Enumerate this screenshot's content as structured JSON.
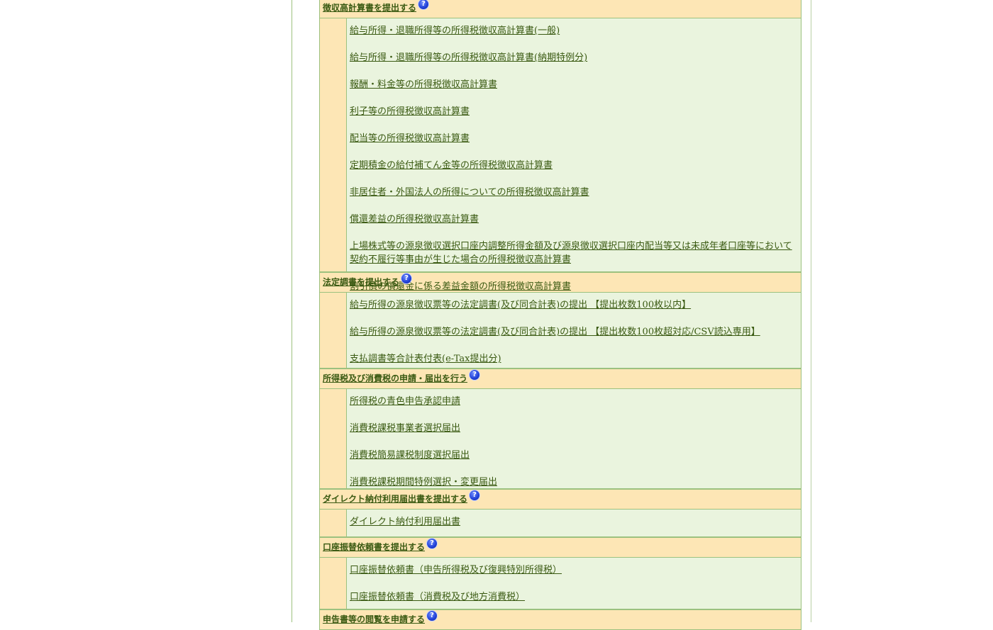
{
  "sections": [
    {
      "title": "徴収高計算書を提出する",
      "items": [
        "給与所得・退職所得等の所得税徴収高計算書(一般)",
        "給与所得・退職所得等の所得税徴収高計算書(納期特例分)",
        "報酬・料金等の所得税徴収高計算書",
        "利子等の所得税徴収高計算書",
        "配当等の所得税徴収高計算書",
        "定期積金の給付補てん金等の所得税徴収高計算書",
        "非居住者・外国法人の所得についての所得税徴収高計算書",
        "償還差益の所得税徴収高計算書",
        "上場株式等の源泉徴収選択口座内調整所得金額及び源泉徴収選択口座内配当等又は未成年者口座等において契約不履行等事由が生じた場合の所得税徴収高計算書",
        "割引債の償還金に係る差益金額の所得税徴収高計算書"
      ]
    },
    {
      "title": "法定調書を提出する",
      "items": [
        "給与所得の源泉徴収票等の法定調書(及び同合計表)の提出 【提出枚数100枚以内】",
        "給与所得の源泉徴収票等の法定調書(及び同合計表)の提出 【提出枚数100枚超対応/CSV読込専用】",
        "支払調書等合計表付表(e-Tax提出分)"
      ]
    },
    {
      "title": "所得税及び消費税の申請・届出を行う",
      "items": [
        "所得税の青色申告承認申請",
        "消費税課税事業者選択届出",
        "消費税簡易課税制度選択届出",
        "消費税課税期間特例選択・変更届出"
      ]
    },
    {
      "title": "ダイレクト納付利用届出書を提出する",
      "items": [
        "ダイレクト納付利用届出書"
      ]
    },
    {
      "title": "口座振替依頼書を提出する",
      "items": [
        "口座振替依頼書（申告所得税及び復興特別所得税）",
        "口座振替依頼書（消費税及び地方消費税）"
      ]
    },
    {
      "title": "申告書等の閲覧を申請する",
      "items": []
    }
  ],
  "help_icon_glyph": "?",
  "colors": {
    "header_bg": "#fde6b5",
    "body_bg": "#eaf4de",
    "border": "#9cc17f",
    "link": "#3a5a12",
    "help_icon": "#1f3fd6"
  }
}
